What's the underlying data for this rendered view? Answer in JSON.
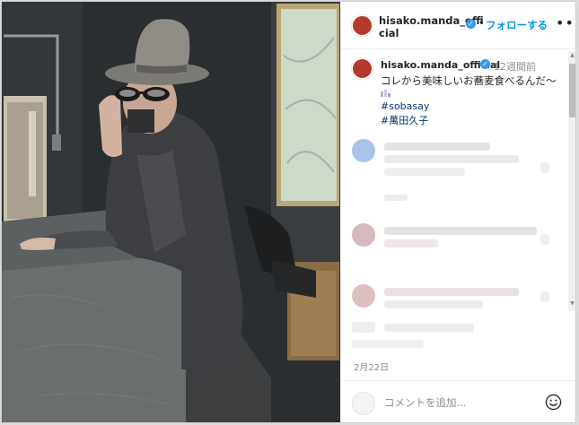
{
  "post": {
    "username": "hisako.manda_official",
    "follow_label": "フォローする",
    "header_separator": "•",
    "more_label": "•••",
    "verified_mark": "✓"
  },
  "caption": {
    "username": "hisako.manda_official",
    "time": "12週間前",
    "text": "コレから美味しいお蕎麦食べるんだ〜",
    "hashtags": [
      "#sobasay",
      "#萬田久子"
    ]
  },
  "post_date": "2月22日",
  "comment_box": {
    "placeholder": "コメントを追加..."
  },
  "scrollbar": {
    "up_arrow": "▲",
    "down_arrow": "▼"
  },
  "colors": {
    "link": "#0095f6",
    "hashtag": "#00376b",
    "verified": "#3897f0",
    "muted": "#8e8e8e",
    "text": "#262626"
  }
}
